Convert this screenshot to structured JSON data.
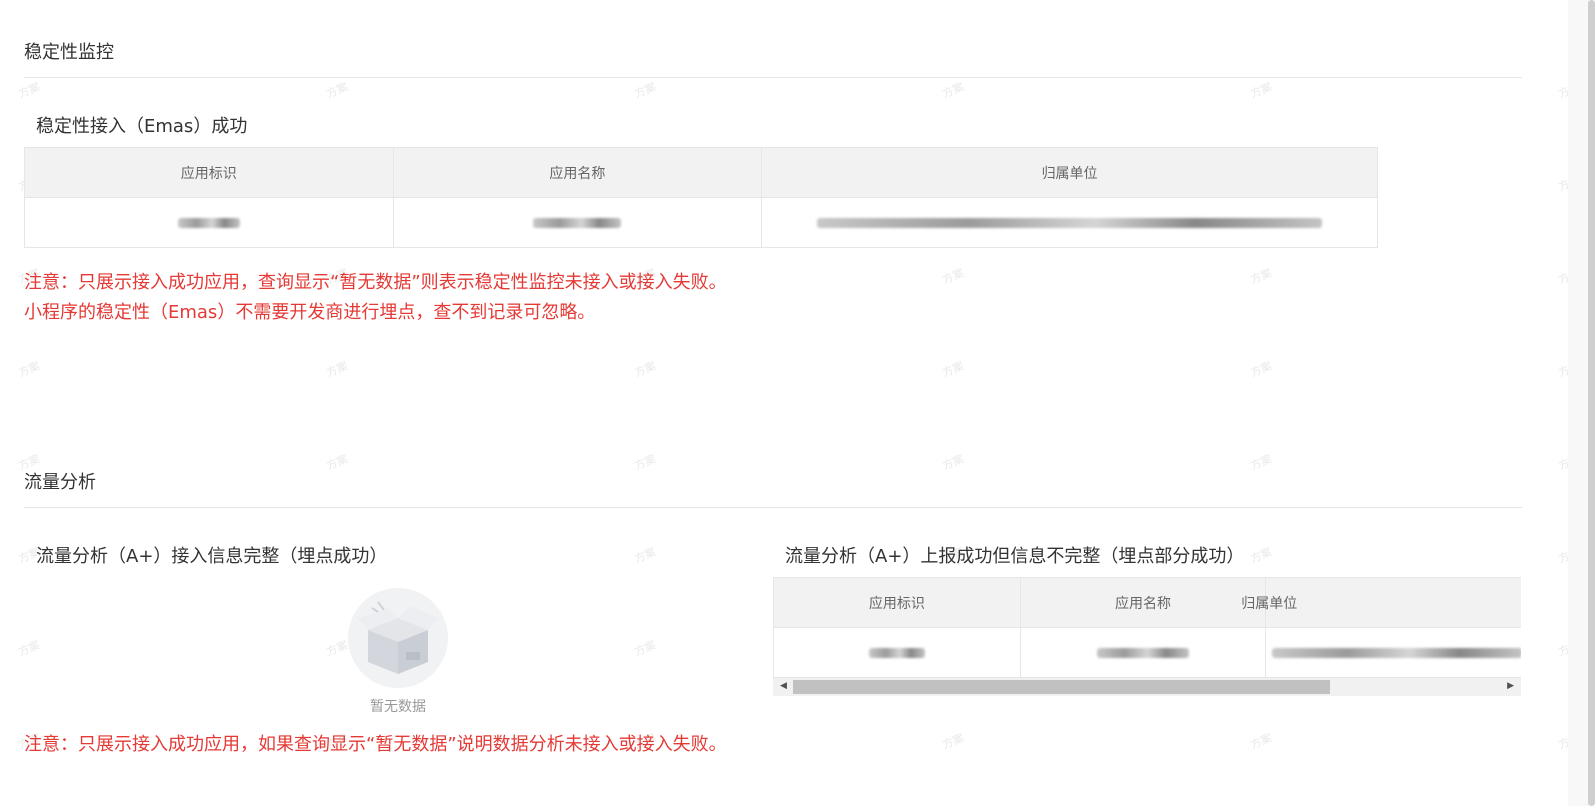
{
  "watermark": "方案",
  "stability": {
    "section_title": "稳定性监控",
    "sub_title": "稳定性接入（Emas）成功",
    "columns": [
      "应用标识",
      "应用名称",
      "归属单位"
    ],
    "notice_line1": "注意：只展示接入成功应用，查询显示“暂无数据”则表示稳定性监控未接入或接入失败。",
    "notice_line2": "小程序的稳定性（Emas）不需要开发商进行埋点，查不到记录可忽略。"
  },
  "traffic": {
    "section_title": "流量分析",
    "complete_title": "流量分析（A+）接入信息完整（埋点成功）",
    "empty_text": "暂无数据",
    "partial_title": "流量分析（A+）上报成功但信息不完整（埋点部分成功）",
    "columns": [
      "应用标识",
      "应用名称",
      "归属单位"
    ],
    "notice": "注意：只展示接入成功应用，如果查询显示“暂无数据”说明数据分析未接入或接入失败。"
  },
  "colors": {
    "notice": "#e53935",
    "header_bg": "#f2f2f2",
    "border": "#e6e6e6"
  }
}
